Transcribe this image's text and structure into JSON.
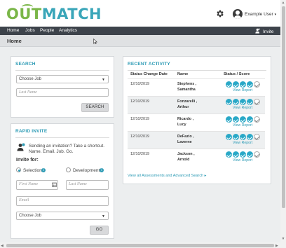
{
  "header": {
    "logo_out": "OUT",
    "logo_match": "MATCH",
    "user_name": "Example User",
    "user_caret": "▾"
  },
  "nav": {
    "items": [
      "Home",
      "Jobs",
      "People",
      "Analytics"
    ],
    "invite_label": "Invite"
  },
  "page": {
    "title": "Home"
  },
  "search": {
    "title": "SEARCH",
    "job_select": "Choose Job",
    "last_name_placeholder": "Last Name",
    "button_label": "SEARCH"
  },
  "rapid_invite": {
    "title": "RAPID INVITE",
    "message": "Sending an invitation? Take a shortcut. Name. Email. Job. Go.",
    "invite_for_label": "Invite for:",
    "radio_selection": "Selection",
    "radio_development": "Development",
    "first_name_placeholder": "First Name",
    "last_name_placeholder": "Last Name",
    "email_placeholder": "Email",
    "job_select": "Choose Job",
    "go_label": "GO"
  },
  "recent_activity": {
    "title": "RECENT ACTIVITY",
    "columns": [
      "Status Change Date",
      "Name",
      "Status / Score"
    ],
    "rows": [
      {
        "date": "12/10/2019",
        "name_line1": "Stephens ,",
        "name_line2": "Samantha",
        "link": "View Report"
      },
      {
        "date": "12/10/2019",
        "name_line1": "Fonzarelli ,",
        "name_line2": "Arthur",
        "link": "View Report"
      },
      {
        "date": "12/10/2019",
        "name_line1": "Ricardo ,",
        "name_line2": "Lucy",
        "link": "View Report"
      },
      {
        "date": "12/10/2019",
        "name_line1": "DeFazio ,",
        "name_line2": "Laverne",
        "link": "View Report"
      },
      {
        "date": "12/10/2019",
        "name_line1": "Jackson ,",
        "name_line2": "Arnold",
        "link": "View Report"
      }
    ],
    "view_all_link": "View all Assessments and Advanced Search ▸"
  },
  "colors": {
    "accent": "#2d9bb5",
    "logo_green": "#7ab648",
    "nav_bg": "#3d434b"
  }
}
